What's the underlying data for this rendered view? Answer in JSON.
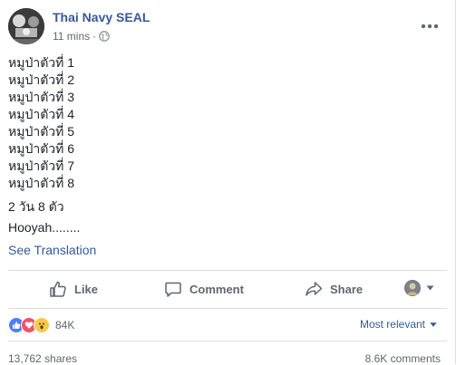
{
  "post": {
    "page_name": "Thai Navy SEAL",
    "time": "11 mins",
    "separator": "·",
    "lines": [
      "หมูป่าตัวที่ 1",
      "หมูป่าตัวที่ 2",
      "หมูป่าตัวที่ 3",
      "หมูป่าตัวที่ 4",
      "หมูป่าตัวที่ 5",
      "หมูป่าตัวที่ 6",
      "หมูป่าตัวที่ 7",
      "หมูป่าตัวที่ 8"
    ],
    "summary": "2 วัน 8 ตัว",
    "closing": "Hooyah........",
    "see_translation": "See Translation"
  },
  "actions": {
    "like": "Like",
    "comment": "Comment",
    "share": "Share"
  },
  "stats": {
    "reactions_count": "84K",
    "sort_label": "Most relevant",
    "shares": "13,762 shares",
    "comments": "8.6K comments"
  },
  "icons": {
    "globe": "globe-icon",
    "more": "more-options-icon",
    "like": "thumbs-up-icon",
    "comment": "comment-bubble-icon",
    "share": "share-arrow-icon",
    "dropdown": "caret-down-icon"
  },
  "colors": {
    "link": "#385898",
    "muted": "#606770",
    "like_reaction": "#4f7ef8",
    "love_reaction": "#f25268",
    "wow_reaction": "#f7c94a"
  }
}
